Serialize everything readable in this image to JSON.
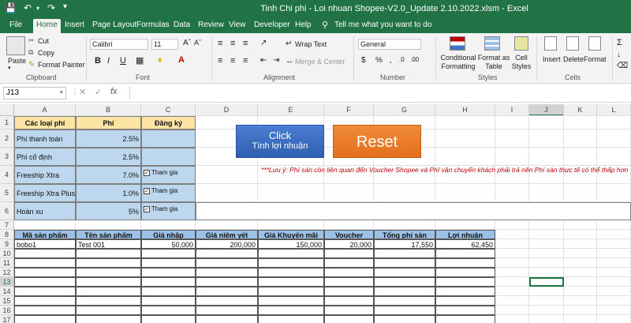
{
  "window": {
    "title": "Tinh Chi phi - Loi nhuan Shopee-V2.0_Update 2.10.2022.xlsm  -  Excel"
  },
  "tabs": [
    "File",
    "Home",
    "Insert",
    "Page Layout",
    "Formulas",
    "Data",
    "Review",
    "View",
    "Developer",
    "Help"
  ],
  "tell_me": "Tell me what you want to do",
  "ribbon": {
    "paste": "Paste",
    "cut": "Cut",
    "copy": "Copy",
    "format_painter": "Format Painter",
    "clipboard": "Clipboard",
    "font_name": "Calibri",
    "font_size": "11",
    "font_group": "Font",
    "bold": "B",
    "italic": "I",
    "underline": "U",
    "wrap_text": "Wrap Text",
    "merge_center": "Merge & Center",
    "alignment": "Alignment",
    "number_format": "General",
    "number": "Number",
    "conditional_formatting": "Conditional Formatting",
    "format_as_table": "Format as Table",
    "cell_styles": "Cell Styles",
    "styles": "Styles",
    "insert": "Insert",
    "delete": "Delete",
    "format": "Format",
    "cells": "Cells"
  },
  "name_box": "J13",
  "columns": [
    "A",
    "B",
    "C",
    "D",
    "E",
    "F",
    "G",
    "H",
    "I",
    "J",
    "K",
    "L"
  ],
  "rows": [
    "1",
    "2",
    "3",
    "4",
    "5",
    "6",
    "7",
    "8",
    "9",
    "10",
    "11",
    "12",
    "13",
    "14",
    "15",
    "16",
    "17"
  ],
  "fees_table": {
    "header_name": "Các loại phí",
    "header_fee": "Phí",
    "header_register": "Đăng ký",
    "rows": [
      {
        "name": "Phí thanh toán",
        "fee": "2.5%",
        "register": ""
      },
      {
        "name": "Phí cố định",
        "fee": "2.5%",
        "register": ""
      },
      {
        "name": "Freeship Xtra",
        "fee": "7.0%",
        "register": "Tham gia"
      },
      {
        "name": "Freeship Xtra Plus",
        "fee": "1.0%",
        "register": "Tham gia"
      },
      {
        "name": "Hoàn xu",
        "fee": "5%",
        "register": "Tham gia"
      }
    ]
  },
  "buttons": {
    "click_line1": "Click",
    "click_line2": "Tính lợi nhuận",
    "reset": "Reset"
  },
  "note": "***Lưu ý: Phí sàn còn liên quan đến Voucher Shopee và Phí vận chuyển khách phải trả nên Phí sàn thực tế có thể thấp hơn",
  "product_table": {
    "headers": [
      "Mã sản phẩm",
      "Tên sản phẩm",
      "Giá nhập",
      "Giá niêm yết",
      "Giá Khuyến mãi",
      "Voucher",
      "Tổng phí sàn",
      "Lợi nhuận"
    ],
    "row": [
      "bobo1",
      "Test 001",
      "50,000",
      "200,000",
      "150,000",
      "20,000",
      "17,550",
      "62,450"
    ]
  },
  "colors": {
    "excel_green": "#217346",
    "blue_cell": "#bdd7ee",
    "yellow_cell": "#fce4a4",
    "header_blue": "#9bc2e6"
  }
}
